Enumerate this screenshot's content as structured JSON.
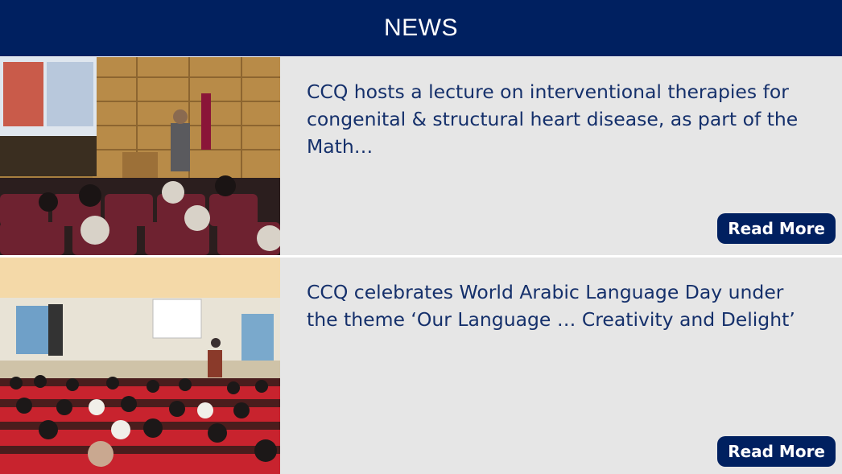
{
  "header": {
    "title": "NEWS"
  },
  "colors": {
    "header_bg": "#002060",
    "item_bg": "#e6e6e6",
    "headline": "#15306b",
    "button_bg": "#002060"
  },
  "news": [
    {
      "headline": "CCQ hosts a lecture on interventional therapies for congenital & structural heart disease, as part of the Math…",
      "button_label": "Read More",
      "image_icon": "lecture-hall-photo"
    },
    {
      "headline": "CCQ celebrates World Arabic Language Day under the theme ‘Our Language … Creativity and Delight’",
      "button_label": "Read More",
      "image_icon": "auditorium-event-photo"
    }
  ]
}
